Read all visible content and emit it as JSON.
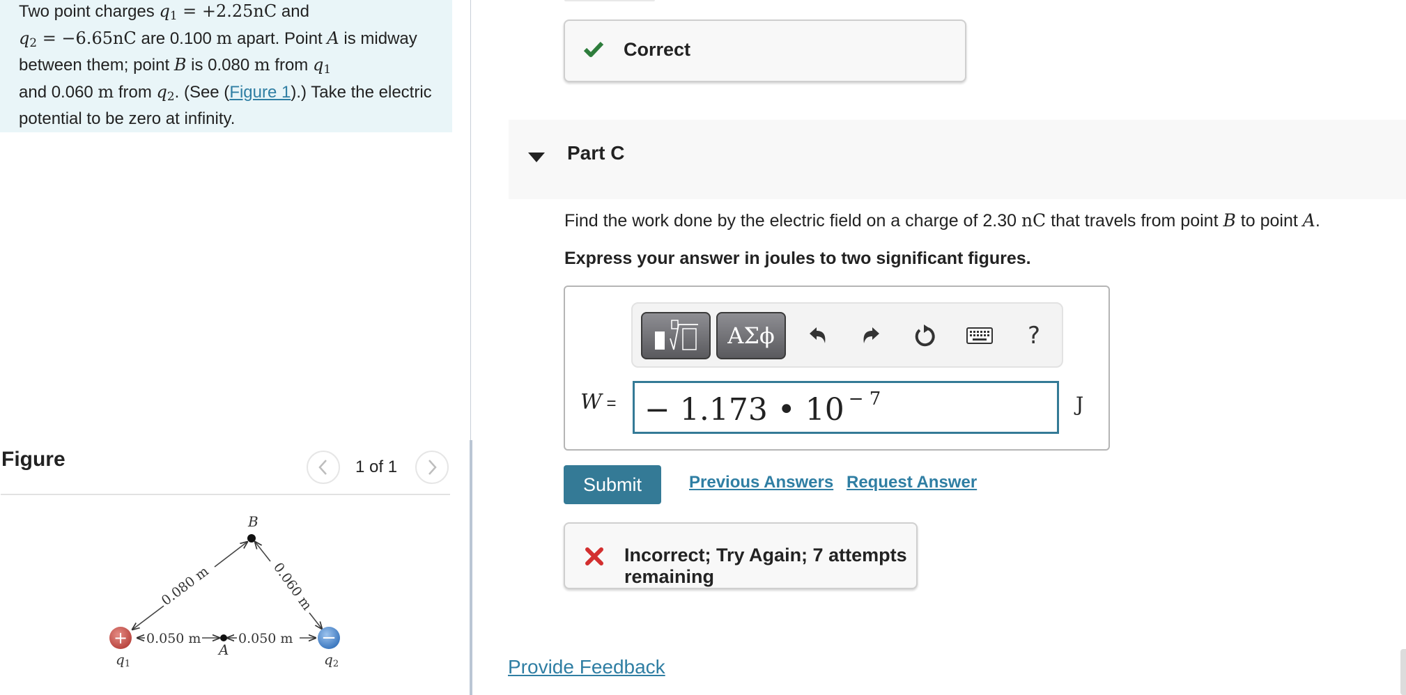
{
  "problem": {
    "text_parts": {
      "p1": "Two point charges ",
      "q1_sym": "q",
      "q1_sub": "1",
      "q1_val": " = +2.25nC",
      "p2": " and ",
      "q2_sym": "q",
      "q2_sub": "2",
      "q2_val": " = −6.65nC",
      "p3": " are 0.100 ",
      "unit_m": "m",
      "p4": " apart. Point ",
      "point_a": "A",
      "p5": " is midway between them; point ",
      "point_b": "B",
      "p6": " is 0.080 ",
      "p7": " from ",
      "p8": " and 0.060 ",
      "p9": " from ",
      "p10": ". (See (",
      "figure_link": "Figure 1",
      "p11": ").) Take the electric potential to be zero at infinity."
    }
  },
  "figure": {
    "title": "Figure",
    "pager": "1 of 1",
    "prev_icon": "chevron-left-icon",
    "next_icon": "chevron-right-icon",
    "labels": {
      "point_b": "B",
      "point_a": "A",
      "q1": "q",
      "q1_sub": "1",
      "q2": "q",
      "q2_sub": "2",
      "dist_q1_b": "0.080 m",
      "dist_q2_b": "0.060 m",
      "dist_q1_a": "0.050 m",
      "dist_a_q2": "0.050 m",
      "plus": "+",
      "minus": "−"
    },
    "colors": {
      "positive": "#c9534f",
      "negative": "#4a86c8"
    }
  },
  "part_b_feedback": {
    "icon": "check-icon",
    "text": "Correct",
    "color": "#2e7d3c"
  },
  "part_c": {
    "title": "Part C",
    "question": {
      "p1": "Find the work done by the electric field on a charge of 2.30 ",
      "unit": "nC",
      "p2": " that travels from point ",
      "b": "B",
      "p3": " to point ",
      "a": "A",
      "p4": "."
    },
    "instruction": "Express your answer in joules to two significant figures.",
    "toolbar": {
      "templates_icon": "templates-icon",
      "greek_label": "ΑΣϕ",
      "undo_icon": "undo-icon",
      "redo_icon": "redo-icon",
      "reset_icon": "reset-icon",
      "keyboard_icon": "keyboard-icon",
      "help_label": "?"
    },
    "variable": "W",
    "equals": " =",
    "answer": {
      "mantissa": "− 1.173 • 10",
      "exponent": "− 7"
    },
    "unit": "J",
    "submit_label": "Submit",
    "previous_answers_label": "Previous Answers",
    "request_answer_label": "Request Answer",
    "feedback": {
      "icon": "x-icon",
      "text": "Incorrect; Try Again; 7 attempts remaining",
      "color": "#d32f2f"
    }
  },
  "provide_feedback_label": "Provide Feedback",
  "colors": {
    "accent": "#347a96",
    "link": "#2f7ea3",
    "problem_bg": "#e9f5f8"
  }
}
